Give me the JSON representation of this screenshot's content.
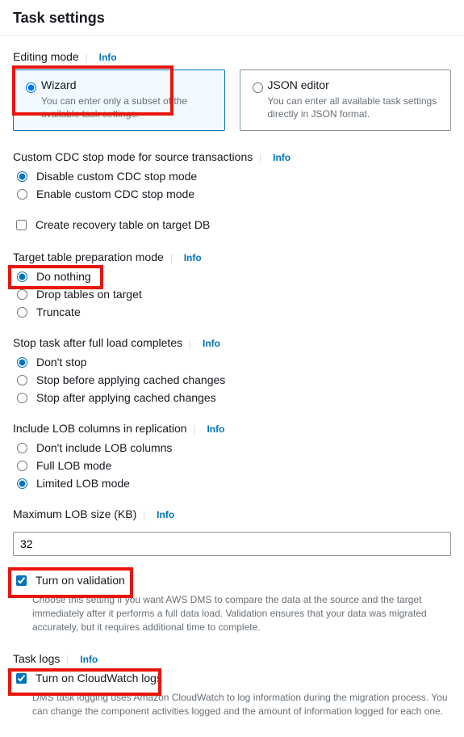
{
  "page": {
    "title": "Task settings"
  },
  "info_label": "Info",
  "editingMode": {
    "label": "Editing mode",
    "wizard": {
      "title": "Wizard",
      "desc": "You can enter only a subset of the available task settings."
    },
    "json": {
      "title": "JSON editor",
      "desc": "You can enter all available task settings directly in JSON format."
    }
  },
  "cdc": {
    "label": "Custom CDC stop mode for source transactions",
    "disable": "Disable custom CDC stop mode",
    "enable": "Enable custom CDC stop mode"
  },
  "recovery": {
    "label": "Create recovery table on target DB"
  },
  "targetPrep": {
    "label": "Target table preparation mode",
    "doNothing": "Do nothing",
    "drop": "Drop tables on target",
    "truncate": "Truncate"
  },
  "stopTask": {
    "label": "Stop task after full load completes",
    "dontStop": "Don't stop",
    "before": "Stop before applying cached changes",
    "after": "Stop after applying cached changes"
  },
  "lob": {
    "label": "Include LOB columns in replication",
    "none": "Don't include LOB columns",
    "full": "Full LOB mode",
    "limited": "Limited LOB mode"
  },
  "maxLob": {
    "label": "Maximum LOB size (KB)",
    "value": "32"
  },
  "validation": {
    "label": "Turn on validation",
    "help": "Choose this setting if you want AWS DMS to compare the data at the source and the target immediately after it performs a full data load. Validation ensures that your data was migrated accurately, but it requires additional time to complete."
  },
  "taskLogs": {
    "label": "Task logs",
    "cwLabel": "Turn on CloudWatch logs",
    "help": "DMS task logging uses Amazon CloudWatch to log information during the migration process. You can change the component activities logged and the amount of information logged for each one."
  }
}
